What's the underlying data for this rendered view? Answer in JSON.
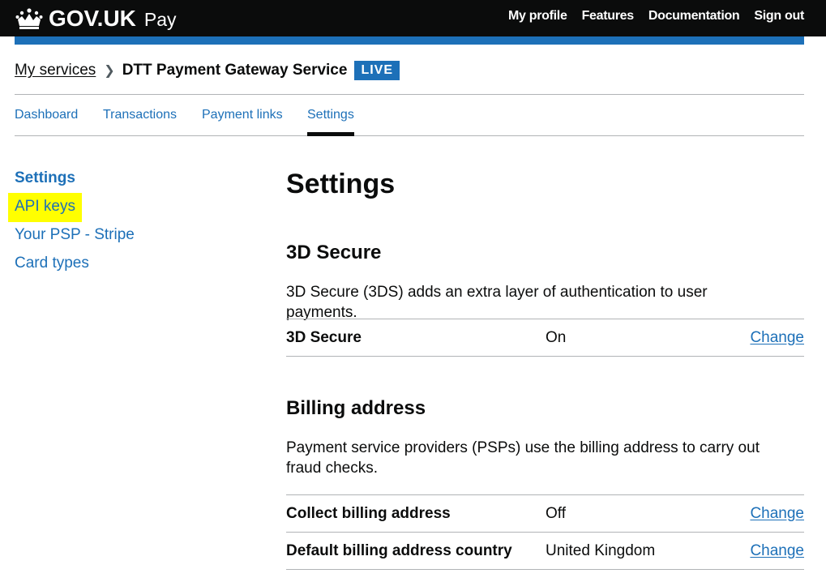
{
  "header": {
    "logo_text": "GOV.UK",
    "product": "Pay",
    "nav": [
      "My profile",
      "Features",
      "Documentation",
      "Sign out"
    ]
  },
  "breadcrumb": {
    "parent": "My services",
    "current": "DTT Payment Gateway Service",
    "tag": "LIVE"
  },
  "tabs": [
    {
      "label": "Dashboard"
    },
    {
      "label": "Transactions"
    },
    {
      "label": "Payment links"
    },
    {
      "label": "Settings",
      "active": true
    }
  ],
  "sidenav": [
    {
      "label": "Settings",
      "current": true
    },
    {
      "label": "API keys",
      "highlighted": true
    },
    {
      "label": "Your PSP - Stripe"
    },
    {
      "label": "Card types"
    }
  ],
  "main": {
    "title": "Settings",
    "secure": {
      "heading": "3D Secure",
      "description": "3D Secure (3DS) adds an extra layer of authentication to user payments.",
      "rows": [
        {
          "key": "3D Secure",
          "value": "On",
          "action": "Change"
        }
      ]
    },
    "billing": {
      "heading": "Billing address",
      "description": "Payment service providers (PSPs) use the billing address to carry out fraud checks.",
      "rows": [
        {
          "key": "Collect billing address",
          "value": "Off",
          "action": "Change"
        },
        {
          "key": "Default billing address country",
          "value": "United Kingdom",
          "action": "Change"
        }
      ]
    }
  },
  "colors": {
    "header_bg": "#0b0c0c",
    "brand_blue": "#1d70b8",
    "highlight": "#ffff00",
    "border": "#b1b4b6"
  }
}
